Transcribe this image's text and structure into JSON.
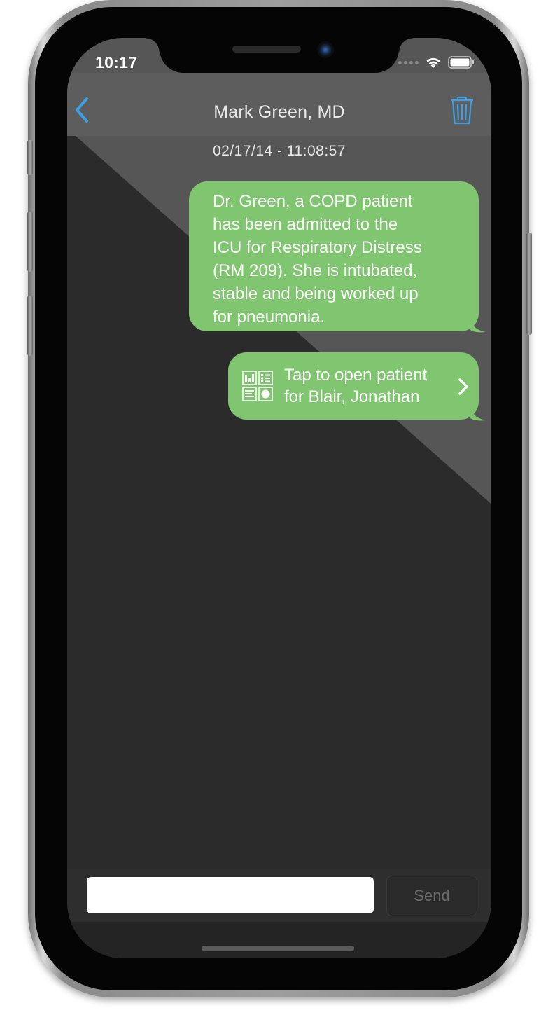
{
  "status_bar": {
    "time": "10:17"
  },
  "nav": {
    "title": "Mark Green, MD",
    "back_icon": "chevron-left-icon",
    "trash_icon": "trash-icon",
    "accent_color": "#3ea0e4"
  },
  "conversation": {
    "timestamp": "02/17/14 - 11:08:57",
    "messages": [
      {
        "text": "Dr. Green, a COPD patient\nhas been admitted to the\nICU for Respiratory Distress\n(RM 209).  She is intubated,\nstable and being worked up\nfor pneumonia."
      },
      {
        "text": "Tap to open patient\nfor Blair, Jonathan",
        "icon": "patient-dashboard-icon",
        "chevron": "chevron-right-icon"
      }
    ],
    "bubble_color": "#80c56f"
  },
  "compose": {
    "input_value": "",
    "send_label": "Send"
  }
}
